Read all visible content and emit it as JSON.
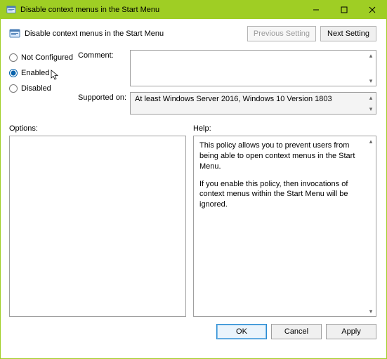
{
  "title": "Disable context menus in the Start Menu",
  "header": {
    "policy_title": "Disable context menus in the Start Menu",
    "previous_label": "Previous Setting",
    "next_label": "Next Setting"
  },
  "radios": {
    "not_configured": "Not Configured",
    "enabled": "Enabled",
    "disabled": "Disabled",
    "selected": "enabled"
  },
  "fields": {
    "comment_label": "Comment:",
    "comment_value": "",
    "supported_label": "Supported on:",
    "supported_value": "At least Windows Server 2016, Windows 10 Version 1803"
  },
  "panels": {
    "options_label": "Options:",
    "help_label": "Help:",
    "help_p1": "This policy allows you to prevent users from being able to open context menus in the Start Menu.",
    "help_p2": "If you enable this policy, then invocations of context menus within the Start Menu will be ignored."
  },
  "footer": {
    "ok": "OK",
    "cancel": "Cancel",
    "apply": "Apply"
  }
}
